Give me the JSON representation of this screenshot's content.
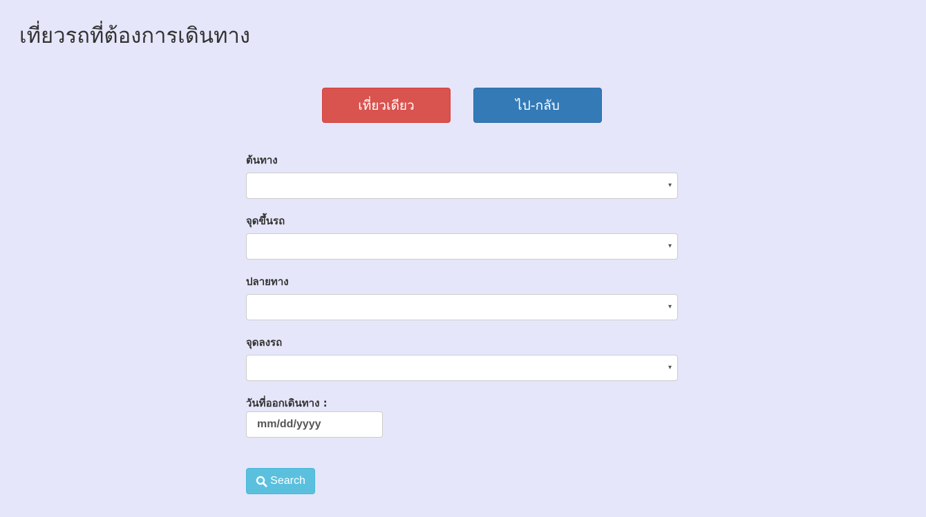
{
  "page": {
    "title": "เที่ยวรถที่ต้องการเดินทาง"
  },
  "trip_type": {
    "one_way": "เที่ยวเดียว",
    "round_trip": "ไป-กลับ"
  },
  "form": {
    "origin_label": "ต้นทาง",
    "boarding_point_label": "จุดขึ้นรถ",
    "destination_label": "ปลายทาง",
    "dropoff_point_label": "จุดลงรถ",
    "departure_date_label": "วันที่ออกเดินทาง :",
    "departure_date_placeholder": "mm/dd/yyyy",
    "dropdown_arrow": "▾"
  },
  "search_button": {
    "label": "Search",
    "icon": "search-icon"
  },
  "colors": {
    "page_background": "#e6e6fa",
    "one_way_button": "#d9534f",
    "round_trip_button": "#337ab7",
    "search_button": "#5bc0de"
  }
}
